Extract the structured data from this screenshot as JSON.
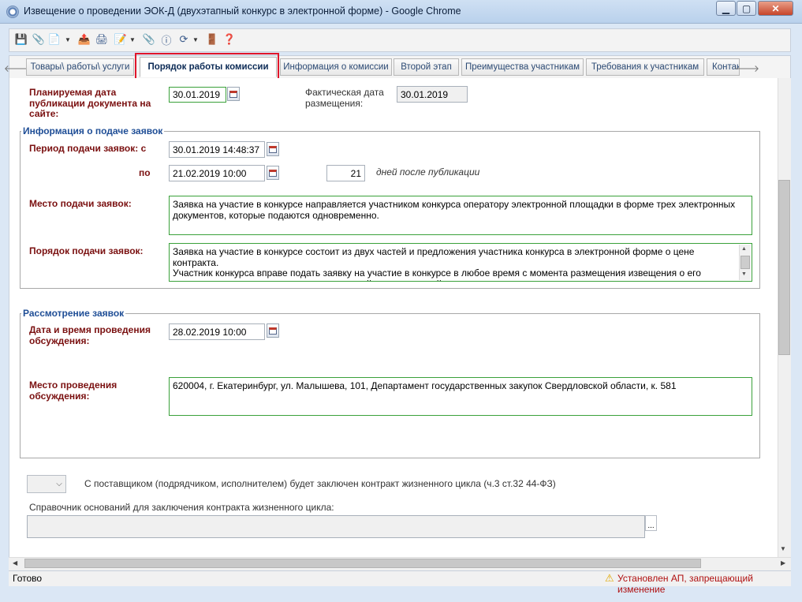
{
  "window": {
    "title": "Извещение о проведении ЭОК-Д (двухэтапный конкурс в электронной форме) - Google Chrome",
    "min": "▁",
    "max": "▢",
    "close": "✕"
  },
  "tabs": [
    {
      "label": "Товары\\ работы\\ услуги"
    },
    {
      "label": "Порядок работы комиссии"
    },
    {
      "label": "Информация о комиссии"
    },
    {
      "label": "Второй этап"
    },
    {
      "label": "Преимущества участникам"
    },
    {
      "label": "Требования к участникам"
    },
    {
      "label": "Контак"
    }
  ],
  "tab_nav": {
    "left": "🡐",
    "right": "🡒"
  },
  "publication": {
    "planned_label": "Планируемая дата публикации документа на сайте:",
    "planned_value": "30.01.2019",
    "actual_label": "Фактическая дата размещения:",
    "actual_value": "30.01.2019"
  },
  "submission": {
    "group_title": "Информация о подаче заявок",
    "period_label": "Период подачи заявок: с",
    "period_from": "30.01.2019 14:48:37",
    "to_label": "по",
    "period_to": "21.02.2019 10:00",
    "days_value": "21",
    "days_label": "дней после публикации",
    "place_label": "Место подачи заявок:",
    "place_text": "Заявка на участие в конкурсе направляется участником конкурса оператору электронной площадки в форме трех электронных документов, которые подаются одновременно.",
    "order_label": "Порядок подачи заявок:",
    "order_text": "Заявка на участие в конкурсе состоит из двух частей и предложения участника конкурса в электронной форме о цене контракта.\nУчастник конкурса вправе подать заявку на участие в конкурсе в любое время с момента размещения извещения о его проведении до предусмотренных конкурсной документацией даты и времени окончания срока подачи таких заявок."
  },
  "review": {
    "group_title": "Рассмотрение заявок",
    "datetime_label": "Дата и время проведения обсуждения:",
    "datetime_value": "28.02.2019 10:00",
    "place_label": "Место проведения обсуждения:",
    "place_text": "620004, г. Екатеринбург, ул. Малышева, 101, Департамент государственных закупок Свердловской области, к. 581"
  },
  "lifecycle": {
    "contract_text": "С поставщиком (подрядчиком, исполнителем) будет заключен контракт жизненного цикла (ч.3 ст.32 44-ФЗ)",
    "reference_label": "Справочник оснований для заключения контракта жизненного цикла:",
    "reference_value": "",
    "ellipsis": "..."
  },
  "status": {
    "ready": "Готово",
    "warning": "Установлен АП, запрещающий изменение"
  },
  "colors": {
    "highlight": "#e0162b",
    "label_red": "#7a1010",
    "group_blue": "#1f4e96",
    "field_green": "#3aa13a"
  }
}
